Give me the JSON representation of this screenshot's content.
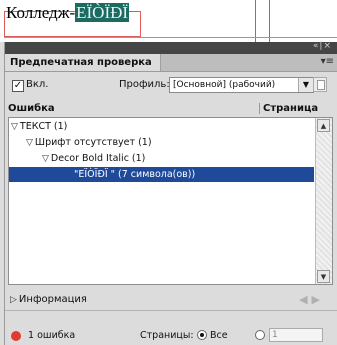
{
  "document": {
    "text_plain": "Колледж-",
    "text_highlight": "ЕЇÒЇÐЇ"
  },
  "panel": {
    "tab_title": "Предпечатная проверка",
    "enabled_label": "Вкл.",
    "enabled_checked": true,
    "profile_label": "Профиль:",
    "profile_value": "[Основной] (рабочий)",
    "col_error": "Ошибка",
    "col_page": "Страница",
    "items": [
      {
        "label": "ТЕКСТ (1)"
      },
      {
        "label": "Шрифт отсутствует (1)"
      },
      {
        "label": "Decor Bold Italic (1)"
      },
      {
        "label": "\"ЕЇÒЇÐЇ \" (7 символа(ов))"
      }
    ],
    "info_label": "Информация",
    "error_count": "1 ошибка",
    "pages_label": "Страницы:",
    "all_label": "Все",
    "range_value": "1"
  },
  "colors": {
    "selection": "#1f4a9a",
    "error_dot": "#e03b2e",
    "highlight": "#1b6b63"
  }
}
